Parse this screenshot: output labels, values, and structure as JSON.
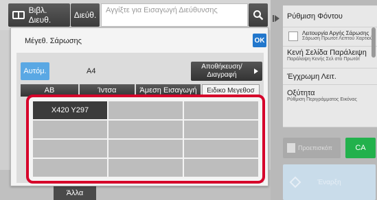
{
  "topbar": {
    "address_book_label": "Βιβλ. Διευθ.",
    "address_label": "Διεύθ.",
    "address_placeholder": "Αγγίξτε για Εισαγωγή Διεύθυνσης",
    "search_icon": "search-icon"
  },
  "dialog": {
    "title": "Μέγεθ. Σάρωσης",
    "ok_label": "OK",
    "auto_label": "Αυτόμ.",
    "current_size": "A4",
    "storage_label": "Αποθήκευση/ Διαγραφή",
    "tabs": [
      {
        "label": "AB"
      },
      {
        "label": "Ίντσα"
      },
      {
        "label": "Άμεση Εισαγωγή"
      },
      {
        "label": "Ειδικο Μεγεθοσ"
      }
    ],
    "custom_sizes": [
      "X420 Y297",
      "",
      "",
      "",
      "",
      "",
      "",
      "",
      "",
      "",
      "",
      ""
    ]
  },
  "right_panel": {
    "items": [
      {
        "title": "Ρύθμιση Φόντου",
        "subtitle": ""
      },
      {
        "title": "Λειτουργία Αργής Σάρωσης",
        "subtitle": "Σάρωση Πρωτοτ Λεπτού Χαρτιού"
      },
      {
        "title": "Κενή Σελίδα Παράλειψη",
        "subtitle": "Παράλειψη Κενής Σελ στο Πρωτότ"
      },
      {
        "title": "Έγχρωμη Λειτ.",
        "subtitle": ""
      },
      {
        "title": "Οξύτητα",
        "subtitle": "Ρύθμιση Περιγράμματος Εικόνας"
      }
    ],
    "preview_label": "Προεπισκόπ",
    "ca_label": "CA",
    "start_label": "Έναρξη"
  },
  "bottom": {
    "other_label": "Άλλα"
  },
  "colors": {
    "accent_blue": "#2277cc",
    "auto_blue": "#5aa8e4",
    "highlight_red": "#d6002a",
    "ca_green": "#22b14c"
  }
}
